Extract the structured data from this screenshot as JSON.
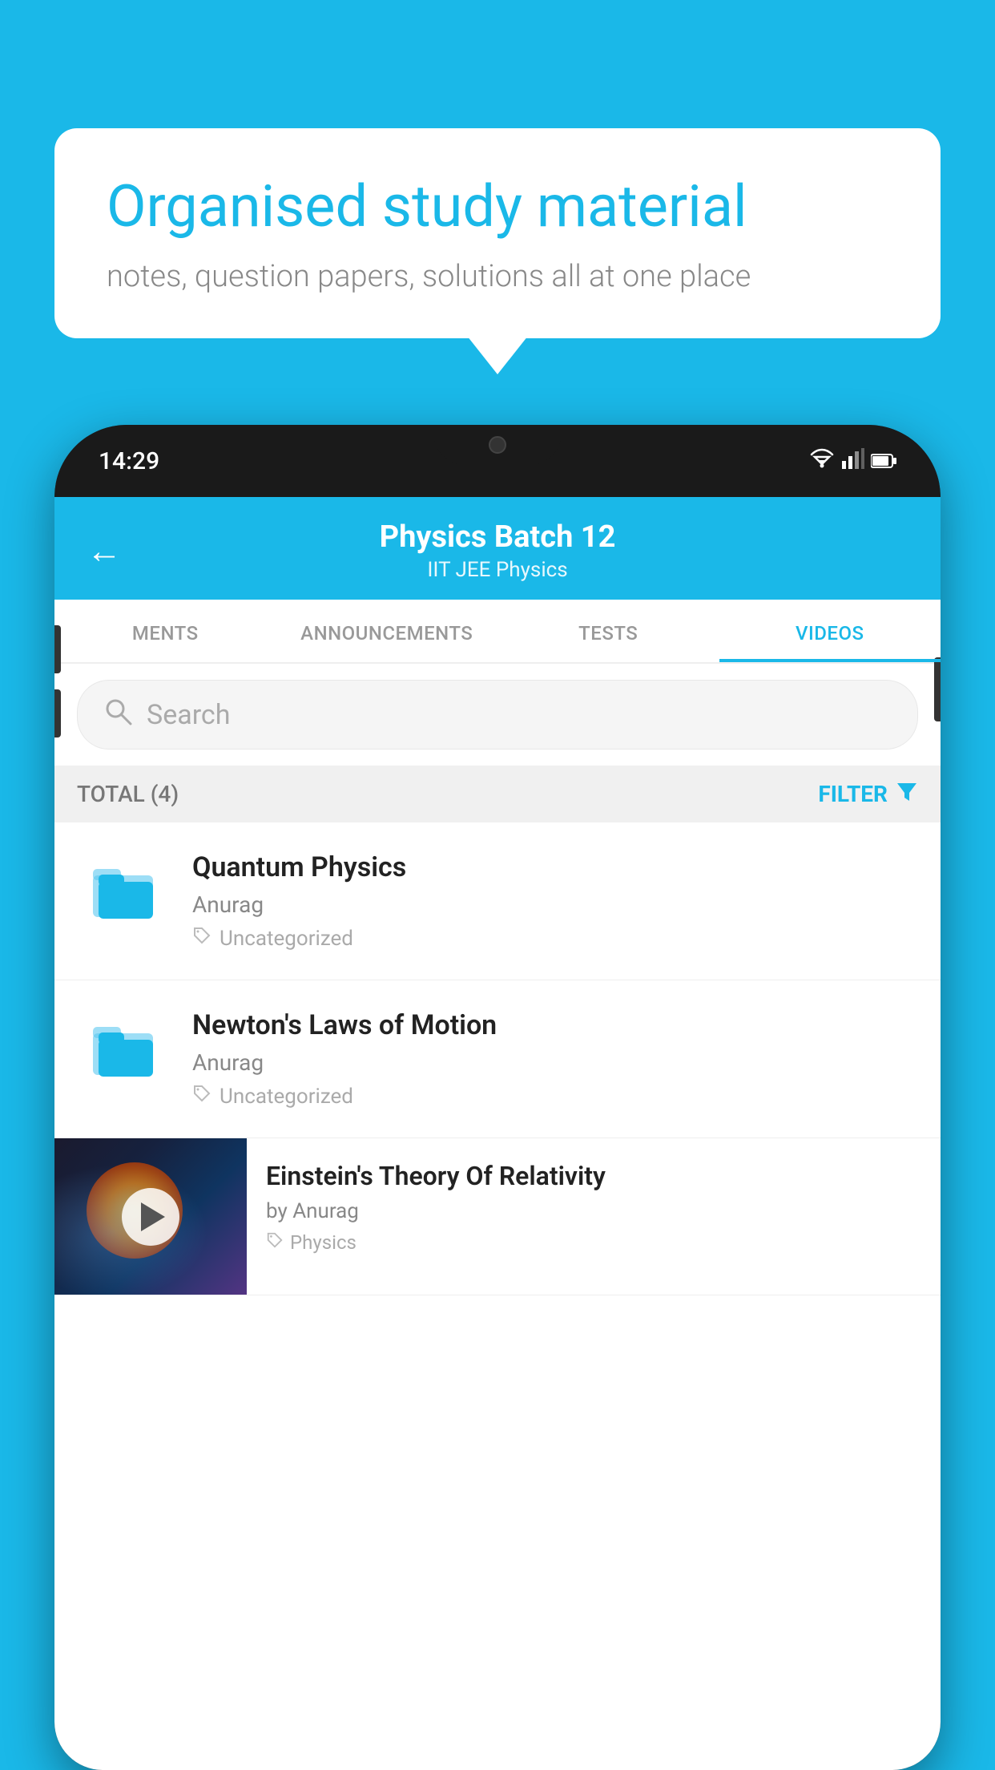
{
  "background_color": "#1ab8e8",
  "bubble": {
    "title": "Organised study material",
    "subtitle": "notes, question papers, solutions all at one place"
  },
  "phone": {
    "time": "14:29",
    "header": {
      "title": "Physics Batch 12",
      "subtitle": "IIT JEE   Physics",
      "back_label": "←"
    },
    "tabs": [
      {
        "label": "MENTS",
        "active": false
      },
      {
        "label": "ANNOUNCEMENTS",
        "active": false
      },
      {
        "label": "TESTS",
        "active": false
      },
      {
        "label": "VIDEOS",
        "active": true
      }
    ],
    "search": {
      "placeholder": "Search"
    },
    "filter": {
      "total_label": "TOTAL (4)",
      "filter_label": "FILTER"
    },
    "videos": [
      {
        "id": 1,
        "title": "Quantum Physics",
        "author": "Anurag",
        "tag": "Uncategorized",
        "has_thumbnail": false
      },
      {
        "id": 2,
        "title": "Newton's Laws of Motion",
        "author": "Anurag",
        "tag": "Uncategorized",
        "has_thumbnail": false
      },
      {
        "id": 3,
        "title": "Einstein's Theory Of Relativity",
        "author": "by Anurag",
        "tag": "Physics",
        "has_thumbnail": true
      }
    ]
  }
}
